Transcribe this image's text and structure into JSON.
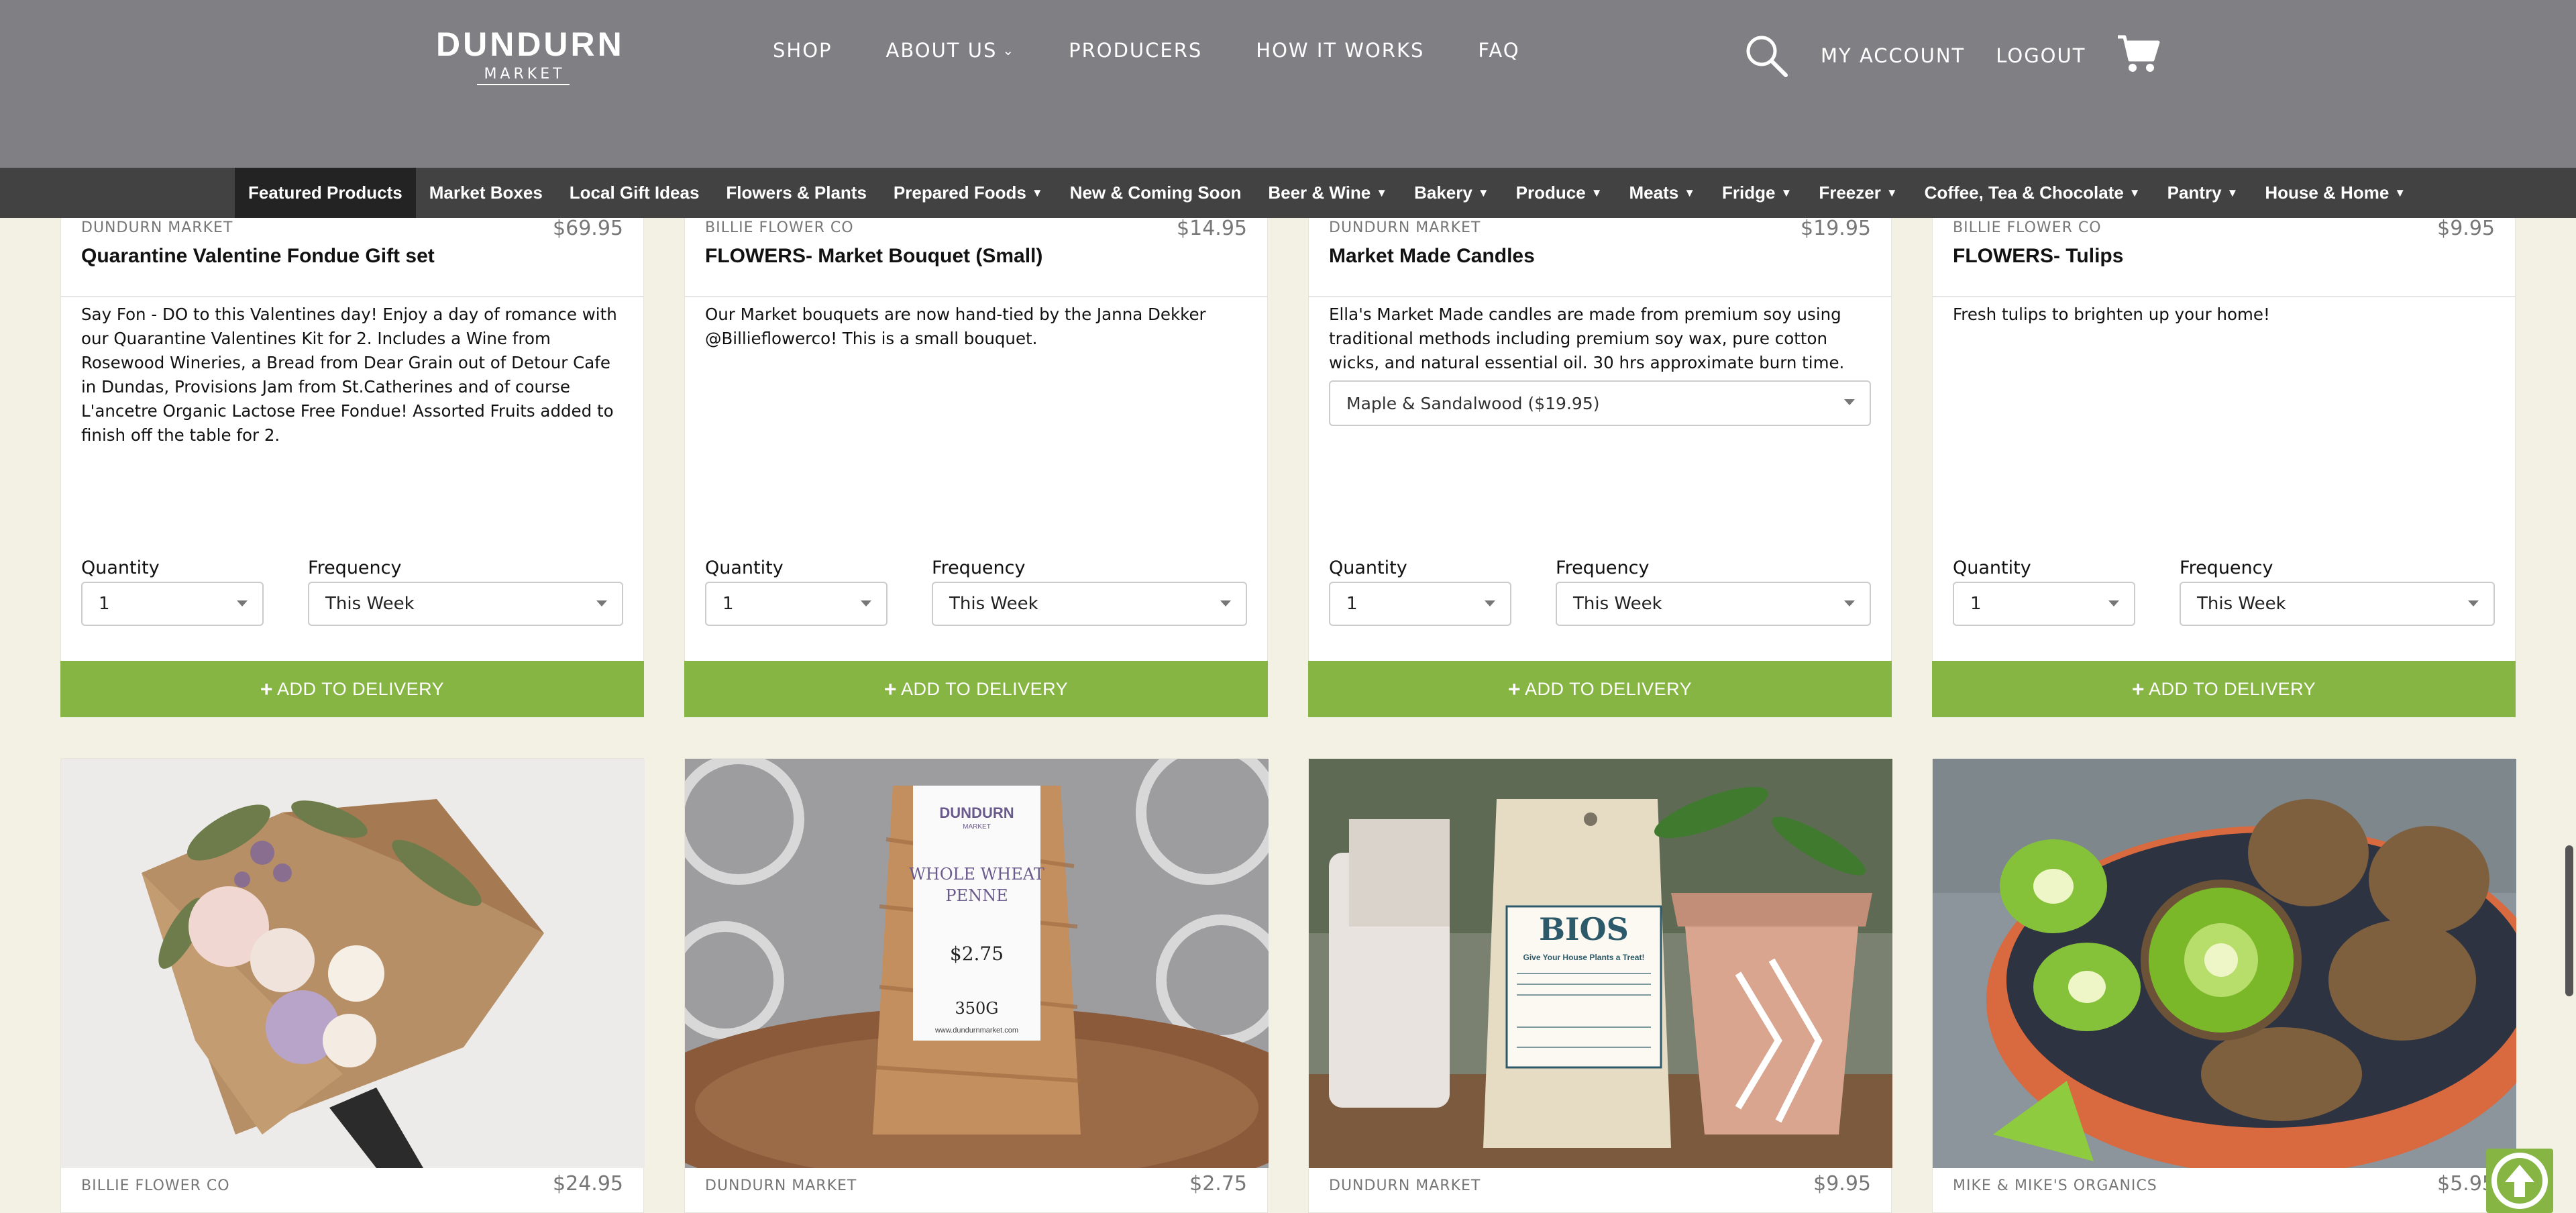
{
  "header": {
    "logo_main": "DUNDURN",
    "logo_sub": "MARKET",
    "nav": [
      {
        "label": "SHOP"
      },
      {
        "label": "ABOUT US",
        "dropdown": true
      },
      {
        "label": "PRODUCERS"
      },
      {
        "label": "HOW IT WORKS"
      },
      {
        "label": "FAQ"
      }
    ],
    "account_label": "MY ACCOUNT",
    "logout_label": "LOGOUT",
    "icons": [
      "search-icon",
      "cart-icon"
    ]
  },
  "categories": [
    {
      "label": "Featured Products",
      "active": true
    },
    {
      "label": "Market Boxes"
    },
    {
      "label": "Local Gift Ideas"
    },
    {
      "label": "Flowers & Plants"
    },
    {
      "label": "Prepared Foods",
      "dropdown": true
    },
    {
      "label": "New & Coming Soon"
    },
    {
      "label": "Beer & Wine",
      "dropdown": true
    },
    {
      "label": "Bakery",
      "dropdown": true
    },
    {
      "label": "Produce",
      "dropdown": true
    },
    {
      "label": "Meats",
      "dropdown": true
    },
    {
      "label": "Fridge",
      "dropdown": true
    },
    {
      "label": "Freezer",
      "dropdown": true
    },
    {
      "label": "Coffee, Tea & Chocolate",
      "dropdown": true
    },
    {
      "label": "Pantry",
      "dropdown": true
    },
    {
      "label": "House & Home",
      "dropdown": true
    }
  ],
  "products": [
    {
      "producer": "DUNDURN MARKET",
      "price": "$69.95",
      "name": "Quarantine Valentine Fondue Gift set",
      "description": "Say Fon - DO to this Valentines day! Enjoy a day of romance with our Quarantine Valentines Kit for 2. Includes a Wine from Rosewood Wineries, a Bread from Dear Grain out of Detour Cafe in Dundas, Provisions Jam from St.Catherines and of course L'ancetre Organic Lactose Free Fondue! Assorted Fruits added to finish off the table for 2.",
      "quantity_label": "Quantity",
      "quantity": "1",
      "frequency_label": "Frequency",
      "frequency": "This Week",
      "add_label": "ADD TO DELIVERY"
    },
    {
      "producer": "BILLIE FLOWER CO",
      "price": "$14.95",
      "name": "FLOWERS- Market Bouquet (Small)",
      "description": "Our Market bouquets are now hand-tied by the Janna Dekker @Billieflowerco! This is a small bouquet.",
      "quantity_label": "Quantity",
      "quantity": "1",
      "frequency_label": "Frequency",
      "frequency": "This Week",
      "add_label": "ADD TO DELIVERY"
    },
    {
      "producer": "DUNDURN MARKET",
      "price": "$19.95",
      "name": "Market Made Candles",
      "description": "Ella's Market Made candles are made from premium soy using traditional methods including premium soy wax, pure cotton wicks, and natural essential oil.  30 hrs approximate burn time.",
      "variant": "Maple & Sandalwood ($19.95)",
      "quantity_label": "Quantity",
      "quantity": "1",
      "frequency_label": "Frequency",
      "frequency": "This Week",
      "add_label": "ADD TO DELIVERY"
    },
    {
      "producer": "BILLIE FLOWER CO",
      "price": "$9.95",
      "name": "FLOWERS- Tulips",
      "description": "Fresh tulips to brighten up your home!",
      "quantity_label": "Quantity",
      "quantity": "1",
      "frequency_label": "Frequency",
      "frequency": "This Week",
      "add_label": "ADD TO DELIVERY"
    }
  ],
  "products_row2": [
    {
      "producer": "BILLIE FLOWER CO",
      "price": "$24.95",
      "image": "flower-bouquet-image"
    },
    {
      "producer": "DUNDURN MARKET",
      "price": "$2.75",
      "image": "penne-pasta-bag-image",
      "label_brand": "DUNDURN",
      "label_sub": "MARKET",
      "label_name": "WHOLE WHEAT",
      "label_name2": "PENNE",
      "label_price": "$2.75",
      "label_weight": "350G",
      "label_url": "www.dundurnmarket.com"
    },
    {
      "producer": "DUNDURN MARKET",
      "price": "$9.95",
      "image": "bios-plant-food-pouch-image",
      "label_brand": "BIOS",
      "label_tag": "Give Your House Plants a Treat!"
    },
    {
      "producer": "MIKE & MIKE'S ORGANICS",
      "price": "$5.95",
      "image": "kiwi-bowl-image"
    }
  ],
  "colors": {
    "header": "#808084",
    "category_bar": "#424242",
    "category_active": "#232323",
    "accent_green": "#87b543",
    "page_bg": "#f2f1e4"
  }
}
